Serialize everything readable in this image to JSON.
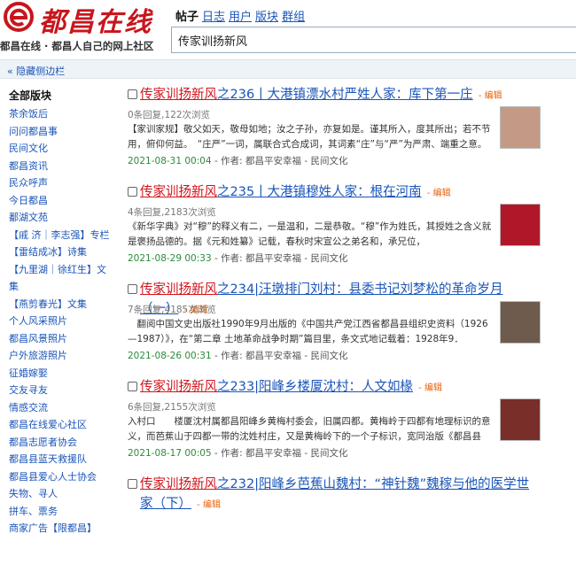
{
  "header": {
    "logo_name": "都昌在线",
    "slogan": "都昌在线 · 都昌人自己的网上社区",
    "nav_current": "帖子",
    "nav_links": [
      "日志",
      "用户",
      "版块",
      "群组"
    ],
    "search_value": "传家训扬新风"
  },
  "hide_sidebar_label": "« 隐藏侧边栏",
  "sidebar": {
    "title": "全部版块",
    "items": [
      "茶余饭后",
      "问问都昌事",
      "民间文化",
      "都昌资讯",
      "民众呼声",
      "今日都昌",
      "鄱湖文苑",
      "【戚 济｜李志强】专栏",
      "【雷结成冰】诗集",
      "【九里湖｜徐红生】文",
      "集",
      "【燕剪春光】文集",
      "个人风采照片",
      "都昌风景照片",
      "户外旅游照片",
      "征婚嫁娶",
      "交友寻友",
      "情感交流",
      "都昌在线爱心社区",
      "都昌志愿者协会",
      "都昌县蓝天救援队",
      "都昌县爱心人士协会",
      "失物、寻人",
      "拼车、票务",
      "商家广告【限都昌】"
    ]
  },
  "threads": [
    {
      "keyword": "传家训扬新风",
      "title_rest": "之236丨大港镇漂水村严姓人家：库下第一庄",
      "edit": "编辑",
      "stats": "0条回复,122次浏览",
      "excerpt": "【家训家规】敬父如天，敬母如地；汝之子孙，亦复如是。谨其所入，度其所出；若不节用，俯仰何益。　“庄严”一词，属联合式合成词，其词素“庄”与“严”为严肃、端重之意。",
      "date": "2021-08-31 00:04",
      "author_label": "作者: ",
      "author": "都昌平安幸福",
      "sep": " - ",
      "forum": "民间文化",
      "thumb_color": "#c49a86"
    },
    {
      "keyword": "传家训扬新风",
      "title_rest": "之235丨大港镇穆姓人家：根在河南",
      "edit": "编辑",
      "stats": "4条回复,2183次浏览",
      "excerpt": "《新华字典》对“穆”的释义有二，一是温和，二是恭敬。“穆”作为姓氏，其授姓之含义就是褒扬品德的。据《元和姓纂》记载，春秋时宋宣公之弟名和，承兄位，",
      "date": "2021-08-29 00:33",
      "author_label": "作者: ",
      "author": "都昌平安幸福",
      "sep": " - ",
      "forum": "民间文化",
      "thumb_color": "#b0182a"
    },
    {
      "keyword": "传家训扬新风",
      "title_rest": "之234|汪墩排门刘村：县委书记刘梦松的革命岁月（一）",
      "edit": "编辑",
      "stats": "7条回复,4185次浏览",
      "excerpt": "　翻阅中国文史出版社1990年9月出版的《中国共产党江西省都昌县组织史资料（1926—1987）》，在“第二章 土地革命战争时期”篇目里，条文式地记载着：1928年9．",
      "date": "2021-08-26 00:31",
      "author_label": "作者: ",
      "author": "都昌平安幸福",
      "sep": " - ",
      "forum": "民间文化",
      "thumb_color": "#6f5a4e"
    },
    {
      "keyword": "传家训扬新风",
      "title_rest": "之233|阳峰乡楼厦沈村：人文如椽",
      "edit": "编辑",
      "stats": "6条回复,2155次浏览",
      "excerpt": "入村口　　楼厦沈村属都昌阳峰乡黄梅村委会，旧属四都。黄梅岭于四都有地理标识的意义，而芭蕉山于四都一带的沈姓村庄，又是黄梅岭下的一个子标识，宽同治版《都昌县",
      "date": "2021-08-17 00:05",
      "author_label": "作者: ",
      "author": "都昌平安幸福",
      "sep": " - ",
      "forum": "民间文化",
      "thumb_color": "#7a2e2a"
    },
    {
      "keyword": "传家训扬新风",
      "title_rest": "之232|阳峰乡芭蕉山魏村：“神针魏”魏稼与他的医学世家（下）",
      "edit": "编辑",
      "stats": "",
      "excerpt": "",
      "date": "",
      "author_label": "",
      "author": "",
      "sep": "",
      "forum": "",
      "thumb_color": "#ffffff"
    }
  ]
}
